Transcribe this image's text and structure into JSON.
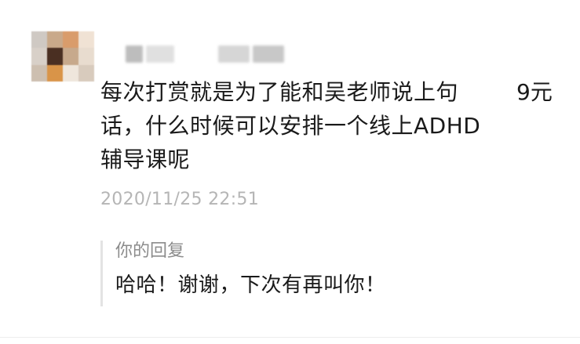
{
  "comment": {
    "text": "每次打赏就是为了能和吴老师说上句话，什么时候可以安排一个线上ADHD辅导课呢",
    "amount": "9元",
    "timestamp": "2020/11/25 22:51"
  },
  "reply": {
    "label": "你的回复",
    "text": "哈哈！谢谢，下次有再叫你！"
  },
  "avatar_colors": [
    "#cfc9c3",
    "#c9a98a",
    "#d99c6b",
    "#f0e2d4",
    "#d8d0c8",
    "#4a2f22",
    "#c7a98c",
    "#e8dccf",
    "#cdbfb0",
    "#d99448",
    "#efe6dc",
    "#d8cbbd"
  ],
  "name_blur_colors": [
    "#bdbdbd",
    "#e0e0e0",
    "#d6d6d6",
    "#c8c8c8"
  ]
}
